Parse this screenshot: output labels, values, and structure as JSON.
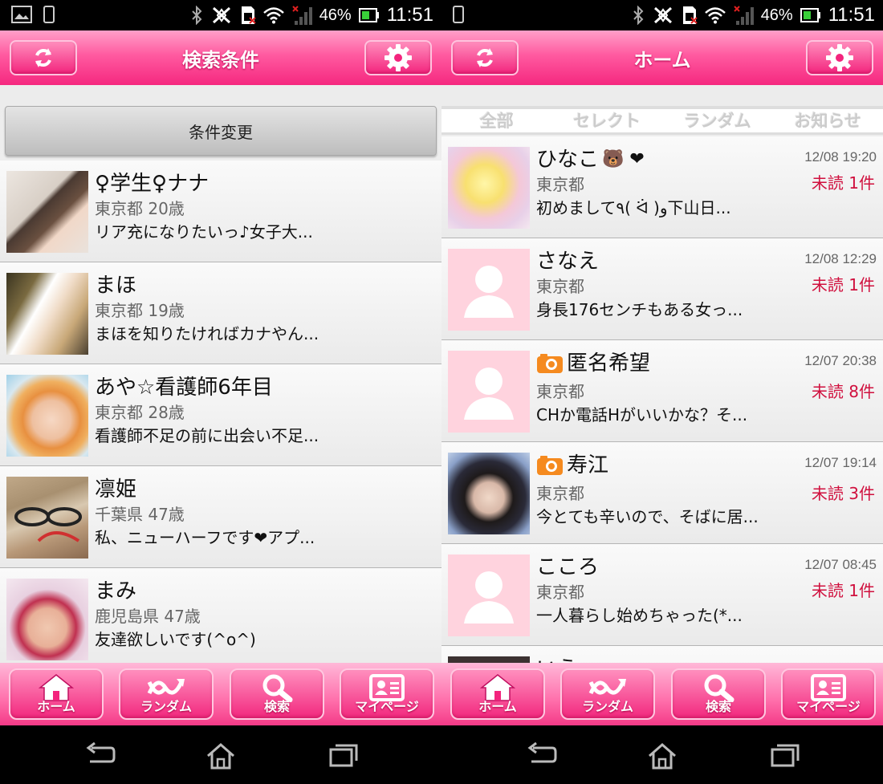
{
  "status_bar": {
    "battery": "46%",
    "time": "11:51"
  },
  "colors": {
    "brand_pink": "#f5287f",
    "unread_red": "#d0103e",
    "placeholder_pink": "#ffd3de"
  },
  "left_screen": {
    "header": {
      "title": "検索条件",
      "left_icon": "refresh-icon",
      "right_icon": "gear-icon"
    },
    "condition_button": "条件変更",
    "users": [
      {
        "name": "♀学生♀ナナ",
        "info": "東京都 20歳",
        "message": "リア充になりたいっ♪女子大..."
      },
      {
        "name": "まほ",
        "info": "東京都 19歳",
        "message": "まほを知りたければカナやん..."
      },
      {
        "name": "あや☆看護師6年目",
        "info": "東京都 28歳",
        "message": "看護師不足の前に出会い不足..."
      },
      {
        "name": "凛姫",
        "info": "千葉県 47歳",
        "message": "私、ニューハーフです❤アプ..."
      },
      {
        "name": "まみ",
        "info": "鹿児島県 47歳",
        "message": "友達欲しいです(^o^)"
      }
    ]
  },
  "right_screen": {
    "header": {
      "title": "ホーム",
      "left_icon": "refresh-icon",
      "right_icon": "gear-icon"
    },
    "tabs": [
      "全部",
      "セレクト",
      "ランダム",
      "お知らせ"
    ],
    "messages": [
      {
        "name": "ひなこ",
        "name_suffix": "🐻 ❤",
        "date": "12/08 19:20",
        "area": "東京都",
        "unread": "未読 1件",
        "message": "初めまして٩( ᐛ )و下山日...",
        "camera": false
      },
      {
        "name": "さなえ",
        "name_suffix": "",
        "date": "12/08 12:29",
        "area": "東京都",
        "unread": "未読 1件",
        "message": "身長176センチもある女っ...",
        "camera": false
      },
      {
        "name": "匿名希望",
        "name_suffix": "",
        "date": "12/07 20:38",
        "area": "東京都",
        "unread": "未読 8件",
        "message": "CHか電話Hがいいかな？そ...",
        "camera": true
      },
      {
        "name": "寿江",
        "name_suffix": "",
        "date": "12/07 19:14",
        "area": "東京都",
        "unread": "未読 3件",
        "message": "今とても辛いので、そばに居...",
        "camera": true
      },
      {
        "name": "こころ",
        "name_suffix": "",
        "date": "12/07 08:45",
        "area": "東京都",
        "unread": "未読 1件",
        "message": "一人暮らし始めちゃった(*...",
        "camera": false
      },
      {
        "name": "いう",
        "name_suffix": "",
        "date": "",
        "area": "",
        "unread": "",
        "message": "",
        "camera": false
      }
    ]
  },
  "bottom_nav": [
    {
      "label": "ホーム",
      "icon": "home-icon"
    },
    {
      "label": "ランダム",
      "icon": "random-icon"
    },
    {
      "label": "検索",
      "icon": "search-icon"
    },
    {
      "label": "マイページ",
      "icon": "mypage-icon"
    }
  ],
  "system_nav": [
    "back-icon",
    "home-icon",
    "recents-icon"
  ]
}
